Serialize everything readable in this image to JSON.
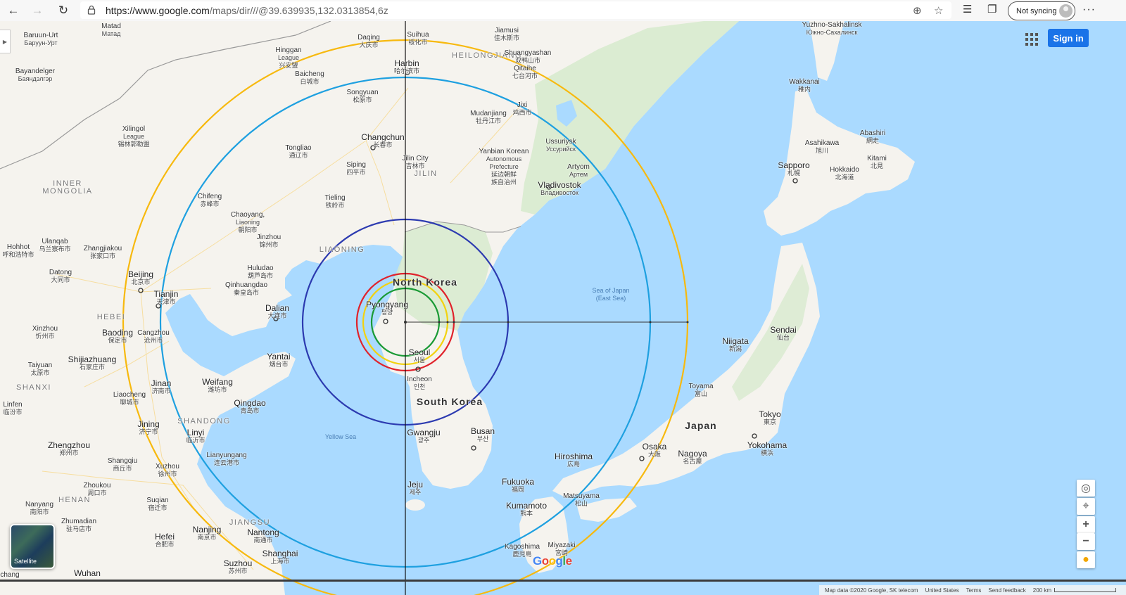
{
  "browser": {
    "url_host": "https://www.google.com",
    "url_path": "/maps/dir///@39.639935,132.0313854,6z",
    "sync_label": "Not syncing"
  },
  "map_ui": {
    "sign_in": "Sign in",
    "satellite": "Satellite",
    "google_logo": "Google",
    "footer": {
      "data": "Map data ©2020 Google, SK telecom",
      "region": "United States",
      "terms": "Terms",
      "feedback": "Send feedback",
      "scale": "200 km"
    }
  },
  "icons": [
    "back-icon",
    "forward-icon",
    "reload-icon",
    "lock-icon",
    "add-icon",
    "star-icon",
    "favorites-icon",
    "collections-icon",
    "menu-icon",
    "apps-icon",
    "chevron-right-icon",
    "globe-icon",
    "location-icon",
    "zoom-in-icon",
    "zoom-out-icon",
    "pegman-icon"
  ],
  "colors": {
    "ring_red": "#e0222b",
    "ring_yellow": "#f2d20f",
    "ring_green": "#1a9a35",
    "ring_navy": "#2c3ab0",
    "ring_cyan": "#1ea0e0",
    "ring_orange": "#f7b90e",
    "water": "#aadaff",
    "land": "#f5f3ee"
  },
  "labels": {
    "mongolia_latin": "Baruun-Urt",
    "mongolia_cyr": "Барyyн-Урт",
    "matad": "Matad",
    "matad_cyr": "Матад",
    "bayandelger": "Bayandelger",
    "bayandelger_cyr": "Баяндэлгэр",
    "daqing": "Daqing",
    "daqing_cn": "大庆市",
    "suihua": "Suihua",
    "suihua_cn": "绥化市",
    "jiamusi": "Jiamusi",
    "jiamusi_cn": "佳木斯市",
    "yuzhno": "Yuzhno-Sakhalinsk",
    "yuzhno_cyr": "Южно-Сахалинск",
    "hinggan": "Hinggan",
    "hinggan2": "League",
    "hinggan_cn": "兴安盟",
    "heilongjiang": "HEILONGJIANG",
    "shuangyashan": "Shuangyashan",
    "shuangyashan_cn": "双鸭山市",
    "harbin": "Harbin",
    "harbin_cn": "哈尔滨市",
    "baicheng": "Baicheng",
    "baicheng_cn": "白城市",
    "qitaihe": "Qitaihe",
    "qitaihe_cn": "七台河市",
    "wakkanai": "Wakkanai",
    "wakkanai_jp": "稚内",
    "songyuan": "Songyuan",
    "songyuan_cn": "松原市",
    "jixi": "Jixi",
    "jixi_cn": "鸡西市",
    "mudanjiang": "Mudanjiang",
    "mudanjiang_cn": "牡丹江市",
    "xilingol": "Xilingol",
    "xilingol2": "League",
    "xilingol_cn": "锡林郭勒盟",
    "changchun": "Changchun",
    "changchun_cn": "长春市",
    "abashiri": "Abashiri",
    "abashiri_jp": "網走",
    "asahikawa": "Asahikawa",
    "asahikawa_jp": "旭川",
    "ussuriysk": "Ussuriysk",
    "ussuriysk_cyr": "Уссурийск",
    "tongliao": "Tongliao",
    "tongliao_cn": "通辽市",
    "jilin_city": "Jilin City",
    "jilin_city_cn": "吉林市",
    "yanbian": "Yanbian Korean",
    "yanbian2": "Autonomous",
    "yanbian3": "Prefecture",
    "yanbian_cn": "延边朝鲜",
    "yanbian_cn2": "族自治州",
    "kitami": "Kitami",
    "kitami_jp": "北見",
    "artyom": "Artyom",
    "artyom_cyr": "Артем",
    "siping": "Siping",
    "siping_cn": "四平市",
    "jilin": "JILIN",
    "sapporo": "Sapporo",
    "sapporo_jp": "札幌",
    "hokkaido": "Hokkaido",
    "hokkaido_jp": "北海道",
    "vladivostok": "Vladivostok",
    "vladivostok_cyr": "Владивосток",
    "inner_mongolia": "INNER",
    "inner_mongolia2": "MONGOLIA",
    "chifeng": "Chifeng",
    "chifeng_cn": "赤峰市",
    "tieling": "Tieling",
    "tieling_cn": "铁岭市",
    "chaoyang": "Chaoyang,",
    "chaoyang2": "Liaoning",
    "chaoyang_cn": "朝阳市",
    "jinzhou": "Jinzhou",
    "jinzhou_cn": "锦州市",
    "ulanqab": "Ulanqab",
    "ulanqab_cn": "乌兰察布市",
    "hohhot": "Hohhot",
    "hohhot_cn": "呼和浩特市",
    "zhangjiakou": "Zhangjiakou",
    "zhangjiakou_cn": "张家口市",
    "liaoning": "LIAONING",
    "huludao": "Huludao",
    "huludao_cn": "葫芦岛市",
    "north_korea": "North Korea",
    "datong": "Datong",
    "datong_cn": "大同市",
    "beijing": "Beijing",
    "beijing_cn": "北京市",
    "qinhuangdao": "Qinhuangdao",
    "qinhuangdao_cn": "秦皇岛市",
    "sea_of_japan": "Sea of Japan",
    "east_sea": "(East Sea)",
    "tianjin": "Tianjin",
    "tianjin_cn": "天津市",
    "pyongyang": "Pyongyang",
    "pyongyang_kr": "평양",
    "dalian": "Dalian",
    "dalian_cn": "大连市",
    "hebei": "HEBEI",
    "sendai": "Sendai",
    "sendai_jp": "仙台",
    "xinzhou": "Xinzhou",
    "xinzhou_cn": "忻州市",
    "baoding": "Baoding",
    "baoding_cn": "保定市",
    "cangzhou": "Cangzhou",
    "cangzhou_cn": "沧州市",
    "niigata": "Niigata",
    "niigata_jp": "新潟",
    "seoul": "Seoul",
    "seoul_kr": "서울",
    "yantai": "Yantai",
    "yantai_cn": "烟台市",
    "shijiazhuang": "Shijiazhuang",
    "shijiazhuang_cn": "石家庄市",
    "taiyuan": "Taiyuan",
    "taiyuan_cn": "太原市",
    "incheon": "Incheon",
    "incheon_kr": "인천",
    "shanxi": "SHANXI",
    "jinan": "Jinan",
    "jinan_cn": "济南市",
    "weifang": "Weifang",
    "weifang_cn": "潍坊市",
    "toyama": "Toyama",
    "toyama_jp": "富山",
    "liaocheng": "Liaocheng",
    "liaocheng_cn": "聊城市",
    "south_korea": "South Korea",
    "qingdao": "Qingdao",
    "qingdao_cn": "青岛市",
    "linfen": "Linfen",
    "linfen_cn": "临汾市",
    "tokyo": "Tokyo",
    "tokyo_jp": "東京",
    "japan": "Japan",
    "shandong": "SHANDONG",
    "jining": "Jining",
    "jining_cn": "济宁市",
    "linyi": "Linyi",
    "linyi_cn": "临沂市",
    "busan": "Busan",
    "busan_kr": "부산",
    "yokohama": "Yokohama",
    "yokohama_jp": "横浜",
    "yellow_sea": "Yellow Sea",
    "gwangju": "Gwangju",
    "gwangju_kr": "광주",
    "osaka": "Osaka",
    "osaka_jp": "大阪",
    "nagoya": "Nagoya",
    "nagoya_jp": "名古屋",
    "zhengzhou": "Zhengzhou",
    "zhengzhou_cn": "郑州市",
    "lianyungang": "Lianyungang",
    "lianyungang_cn": "连云港市",
    "shangqiu": "Shangqiu",
    "shangqiu_cn": "商丘市",
    "hiroshima": "Hiroshima",
    "hiroshima_jp": "広島",
    "xuzhou": "Xuzhou",
    "xuzhou_cn": "徐州市",
    "zhoukou": "Zhoukou",
    "zhoukou_cn": "周口市",
    "jeju": "Jeju",
    "jeju_kr": "제주",
    "fukuoka": "Fukuoka",
    "fukuoka_jp": "福岡",
    "matsuyama": "Matsuyama",
    "matsuyama_jp": "松山",
    "henan": "HENAN",
    "suqian": "Suqian",
    "suqian_cn": "宿迁市",
    "nanyang": "Nanyang",
    "nanyang_cn": "南阳市",
    "kumamoto": "Kumamoto",
    "kumamoto_jp": "熊本",
    "zhumadian": "Zhumadian",
    "zhumadian_cn": "驻马店市",
    "jiangsu": "JIANGSU",
    "nantong": "Nantong",
    "nantong_cn": "南通市",
    "hefei": "Hefei",
    "hefei_cn": "合肥市",
    "nanjing": "Nanjing",
    "nanjing_cn": "南京市",
    "miyazaki": "Miyazaki",
    "miyazaki_jp": "宮崎",
    "kagoshima": "Kagoshima",
    "kagoshima_jp": "鹿児島",
    "shanghai": "Shanghai",
    "shanghai_cn": "上海市",
    "suzhou": "Suzhou",
    "suzhou_cn": "苏州市",
    "wuhan": "Wuhan",
    "changz": "chang"
  }
}
